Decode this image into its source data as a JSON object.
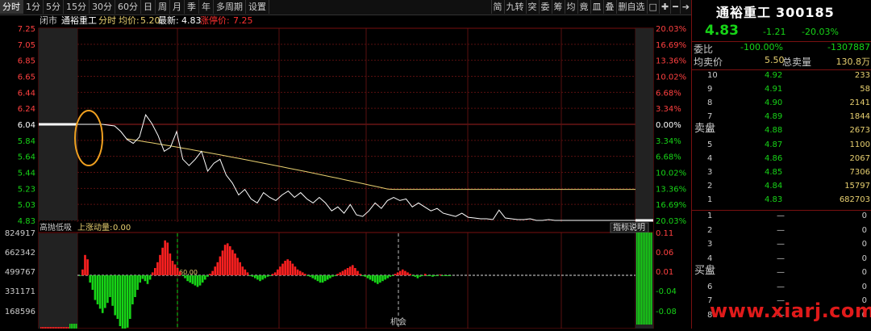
{
  "toolbar": {
    "tabs": [
      "分时",
      "1分",
      "5分",
      "15分",
      "30分",
      "60分",
      "日",
      "周",
      "月",
      "季",
      "年",
      "多周期",
      "设置"
    ],
    "active": 0,
    "right_tools": [
      "简",
      "九转",
      "突",
      "委",
      "筹",
      "均",
      "竟",
      "皿",
      "叠",
      "删自选",
      "□",
      "✚",
      "━",
      "➔"
    ]
  },
  "header": {
    "status": "闭市",
    "stock": "通裕重工",
    "mode": "分时",
    "avg_label": "均价:",
    "avg_value": "5.20",
    "latest_label": "最新:",
    "latest_value": "4.83",
    "limit_label": "涨停价:",
    "limit_value": "7.25"
  },
  "price_axis": {
    "left": [
      "7.25",
      "7.05",
      "6.85",
      "6.65",
      "6.44",
      "6.24",
      "6.04",
      "5.84",
      "5.64",
      "5.44",
      "5.23",
      "5.03",
      "4.83"
    ],
    "right": [
      "20.03%",
      "16.69%",
      "13.36%",
      "10.02%",
      "6.68%",
      "3.34%",
      "0.00%",
      "3.34%",
      "6.68%",
      "10.02%",
      "13.36%",
      "16.69%",
      "20.03%"
    ]
  },
  "indicator": {
    "title": "高抛低吸",
    "sub_label": "上涨动量:",
    "sub_value": "0.00",
    "explain_button": "指标说明",
    "left_axis": [
      "824917",
      "662342",
      "499767",
      "331171",
      "168596"
    ],
    "right_axis": [
      "0.11",
      "0.06",
      "0.01",
      "-0.04",
      "-0.08"
    ],
    "annotation_mid": "机会",
    "annotation_left": "60.00"
  },
  "colors": {
    "up": "#ff2020",
    "down": "#17d417",
    "price_line": "#ffffff",
    "avg_line": "#e8d070",
    "grid": "#5a0f0f",
    "axis_red": "#ff4040",
    "circle": "#f0a020"
  },
  "sidepanel": {
    "name": "通裕重工",
    "code": "300185",
    "price": "4.83",
    "change": "-1.21",
    "change_pct": "-20.03%",
    "weibi_label": "委比",
    "weibi_value": "-100.00%",
    "weicha_value": "-1307887",
    "jmj_label": "均卖价",
    "jmj_value": "5.50",
    "zml_label": "总卖量",
    "zml_value": "130.8万",
    "sell_label": "卖盘",
    "buy_label": "买盘",
    "sell": [
      {
        "n": "10",
        "p": "4.92",
        "v": "233"
      },
      {
        "n": "9",
        "p": "4.91",
        "v": "58"
      },
      {
        "n": "8",
        "p": "4.90",
        "v": "2141"
      },
      {
        "n": "7",
        "p": "4.89",
        "v": "1844"
      },
      {
        "n": "6",
        "p": "4.88",
        "v": "2673"
      },
      {
        "n": "5",
        "p": "4.87",
        "v": "1100"
      },
      {
        "n": "4",
        "p": "4.86",
        "v": "2067"
      },
      {
        "n": "3",
        "p": "4.85",
        "v": "7306"
      },
      {
        "n": "2",
        "p": "4.84",
        "v": "15797"
      },
      {
        "n": "1",
        "p": "4.83",
        "v": "682703"
      }
    ],
    "buy": [
      {
        "n": "1",
        "p": "—",
        "v": "0"
      },
      {
        "n": "2",
        "p": "—",
        "v": "0"
      },
      {
        "n": "3",
        "p": "—",
        "v": "0"
      },
      {
        "n": "4",
        "p": "—",
        "v": "0"
      },
      {
        "n": "5",
        "p": "—",
        "v": "0"
      },
      {
        "n": "6",
        "p": "—",
        "v": "0"
      },
      {
        "n": "7",
        "p": "—",
        "v": "0"
      },
      {
        "n": "8",
        "p": "—",
        "v": "0"
      }
    ]
  },
  "watermark": "www.xiarj.com"
}
